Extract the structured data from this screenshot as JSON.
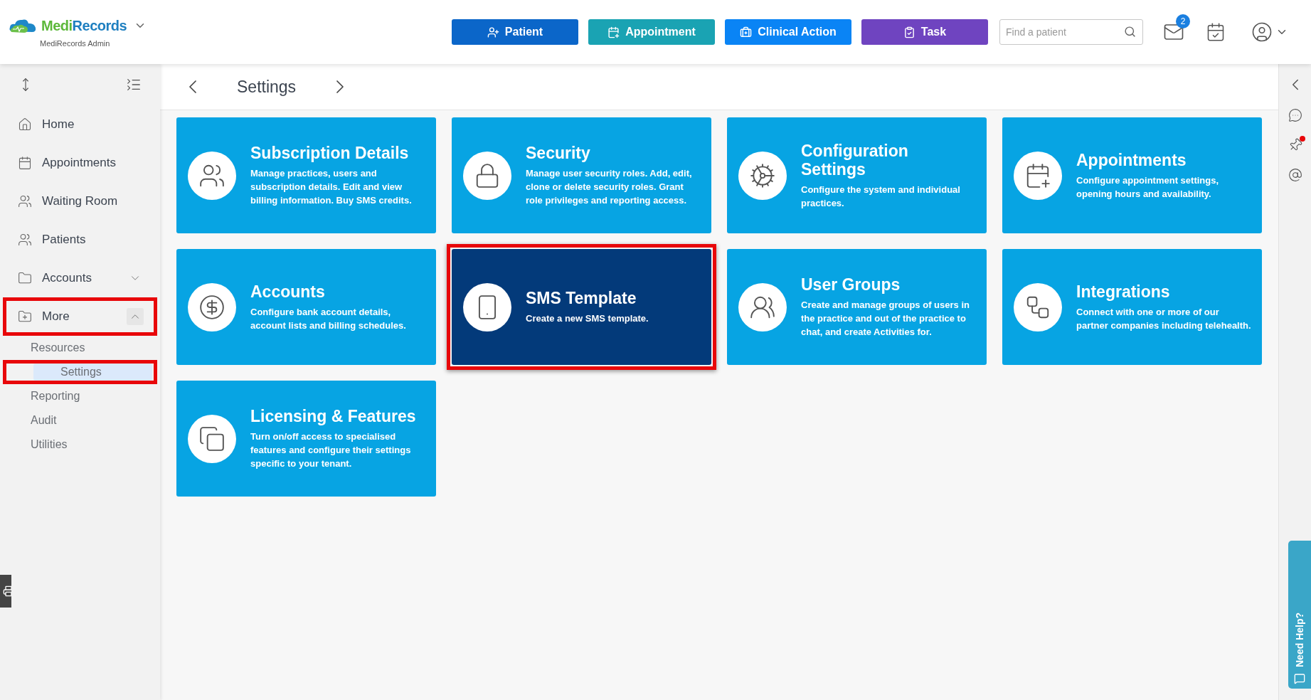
{
  "brand": {
    "name_part_1": "Medi",
    "name_part_2": "Records",
    "subtitle": "MediRecords Admin"
  },
  "header_buttons": [
    {
      "label": "Patient",
      "color": "#0b66c9"
    },
    {
      "label": "Appointment",
      "color": "#1aa3b3"
    },
    {
      "label": "Clinical Action",
      "color": "#0a84f5"
    },
    {
      "label": "Task",
      "color": "#6f44c0"
    }
  ],
  "search": {
    "placeholder": "Find a patient"
  },
  "mail_badge": "2",
  "sidebar": {
    "items": [
      {
        "label": "Home",
        "kind": "link",
        "highlighted": false
      },
      {
        "label": "Appointments",
        "kind": "link",
        "highlighted": false
      },
      {
        "label": "Waiting Room",
        "kind": "link",
        "highlighted": false
      },
      {
        "label": "Patients",
        "kind": "link",
        "highlighted": false
      },
      {
        "label": "Accounts",
        "kind": "group",
        "expanded": false,
        "highlighted": false
      },
      {
        "label": "More",
        "kind": "group",
        "expanded": true,
        "highlighted": true,
        "children": [
          {
            "label": "Resources",
            "selected": false,
            "highlighted": false
          },
          {
            "label": "Settings",
            "selected": true,
            "highlighted": true
          },
          {
            "label": "Reporting",
            "selected": false,
            "highlighted": false
          },
          {
            "label": "Audit",
            "selected": false,
            "highlighted": false
          },
          {
            "label": "Utilities",
            "selected": false,
            "highlighted": false
          }
        ]
      }
    ]
  },
  "page_title": "Settings",
  "cards": [
    {
      "title": "Subscription Details",
      "description": "Manage practices, users and subscription details. Edit and view billing information. Buy SMS credits.",
      "selected": false,
      "highlighted": false
    },
    {
      "title": "Security",
      "description": "Manage user security roles. Add, edit, clone or delete security roles. Grant role privileges and reporting access.",
      "selected": false,
      "highlighted": false
    },
    {
      "title": "Configuration Settings",
      "description": "Configure the system and individual practices.",
      "selected": false,
      "highlighted": false
    },
    {
      "title": "Appointments",
      "description": "Configure appointment settings, opening hours and availability.",
      "selected": false,
      "highlighted": false
    },
    {
      "title": "Accounts",
      "description": "Configure bank account details, account lists and billing schedules.",
      "selected": false,
      "highlighted": false
    },
    {
      "title": "SMS Template",
      "description": "Create a new SMS template.",
      "selected": true,
      "highlighted": true
    },
    {
      "title": "User Groups",
      "description": "Create and manage groups of users in the practice and out of the practice to chat, and create Activities for.",
      "selected": false,
      "highlighted": false
    },
    {
      "title": "Integrations",
      "description": "Connect with one or more of our partner companies including telehealth.",
      "selected": false,
      "highlighted": false
    },
    {
      "title": "Licensing & Features",
      "description": "Turn on/off access to specialised features and configure their settings specific to your tenant.",
      "selected": false,
      "highlighted": false
    }
  ],
  "help_tab": "Need Help?"
}
